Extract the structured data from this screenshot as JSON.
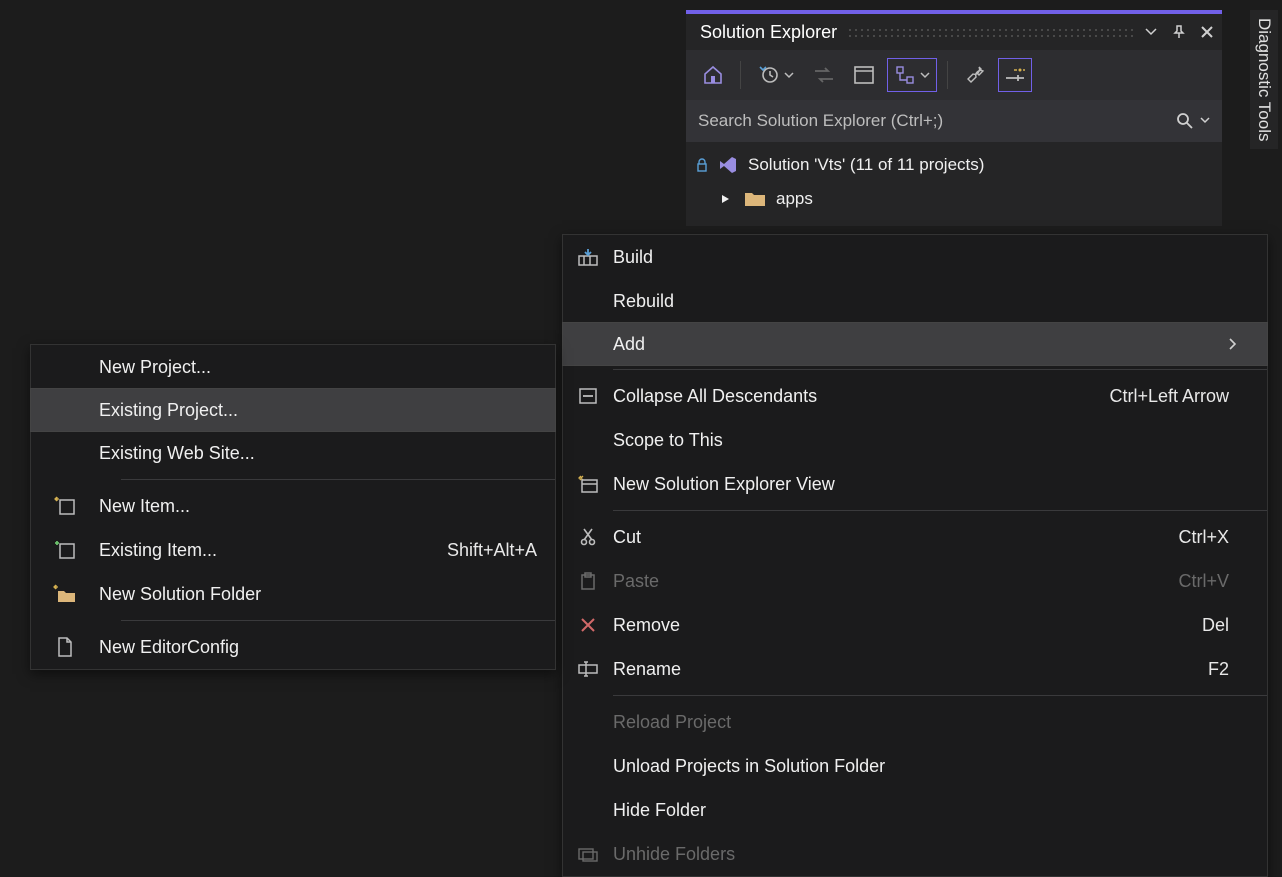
{
  "solution_explorer": {
    "title": "Solution Explorer",
    "search_placeholder": "Search Solution Explorer (Ctrl+;)",
    "solution_label": "Solution 'Vts' (11 of 11 projects)",
    "folder_label": "apps",
    "toolbar_icons": [
      "home",
      "history-drop",
      "sync",
      "window",
      "hierarchy-drop",
      "wrench",
      "properties"
    ]
  },
  "diag_tab": "Diagnostic Tools",
  "context_menu_main": {
    "items": [
      {
        "label": "Build",
        "icon": "build-icon"
      },
      {
        "label": "Rebuild"
      },
      {
        "label": "Add",
        "hover": true,
        "submenu": true
      },
      {
        "sep": true
      },
      {
        "label": "Collapse All Descendants",
        "icon": "collapse-icon",
        "shortcut": "Ctrl+Left Arrow"
      },
      {
        "label": "Scope to This"
      },
      {
        "label": "New Solution Explorer View",
        "icon": "new-view-icon"
      },
      {
        "sep": true
      },
      {
        "label": "Cut",
        "icon": "cut-icon",
        "shortcut": "Ctrl+X"
      },
      {
        "label": "Paste",
        "icon": "paste-icon",
        "shortcut": "Ctrl+V",
        "disabled": true
      },
      {
        "label": "Remove",
        "icon": "remove-icon",
        "shortcut": "Del"
      },
      {
        "label": "Rename",
        "icon": "rename-icon",
        "shortcut": "F2"
      },
      {
        "sep": true
      },
      {
        "label": "Reload Project",
        "disabled": true
      },
      {
        "label": "Unload Projects in Solution Folder"
      },
      {
        "label": "Hide Folder"
      },
      {
        "label": "Unhide Folders",
        "icon": "unhide-icon",
        "disabled": true
      }
    ]
  },
  "context_menu_add": {
    "items": [
      {
        "label": "New Project..."
      },
      {
        "label": "Existing Project...",
        "hover": true
      },
      {
        "label": "Existing Web Site..."
      },
      {
        "sep": true
      },
      {
        "label": "New Item...",
        "icon": "new-item-icon"
      },
      {
        "label": "Existing Item...",
        "icon": "existing-item-icon",
        "shortcut": "Shift+Alt+A"
      },
      {
        "label": "New Solution Folder",
        "icon": "new-folder-icon"
      },
      {
        "sep": true
      },
      {
        "label": "New EditorConfig",
        "icon": "file-icon"
      }
    ]
  }
}
